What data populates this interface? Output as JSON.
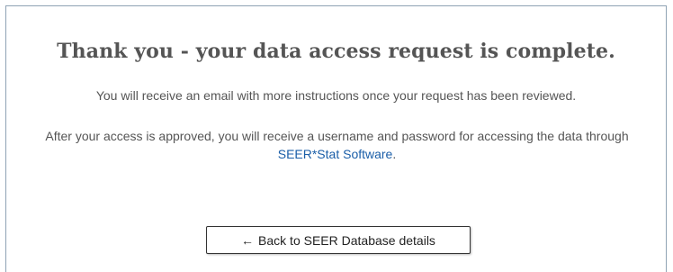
{
  "confirmation": {
    "title": "Thank you - your data access request is complete.",
    "email_message": "You will receive an email with more instructions once your request has been reviewed.",
    "approval_message_before_link": "After your access is approved, you will receive a username and password for accessing the data through ",
    "software_link_text": "SEER*Stat Software",
    "approval_message_after_link": "."
  },
  "back_button": {
    "arrow": "←",
    "label": "Back to SEER Database details"
  },
  "colors": {
    "title_text": "#555555",
    "body_text": "#555555",
    "link": "#1a5ea8",
    "panel_border": "#8fa3b4",
    "button_border": "#333333"
  },
  "icons": {
    "back_arrow": "left-arrow-icon"
  }
}
